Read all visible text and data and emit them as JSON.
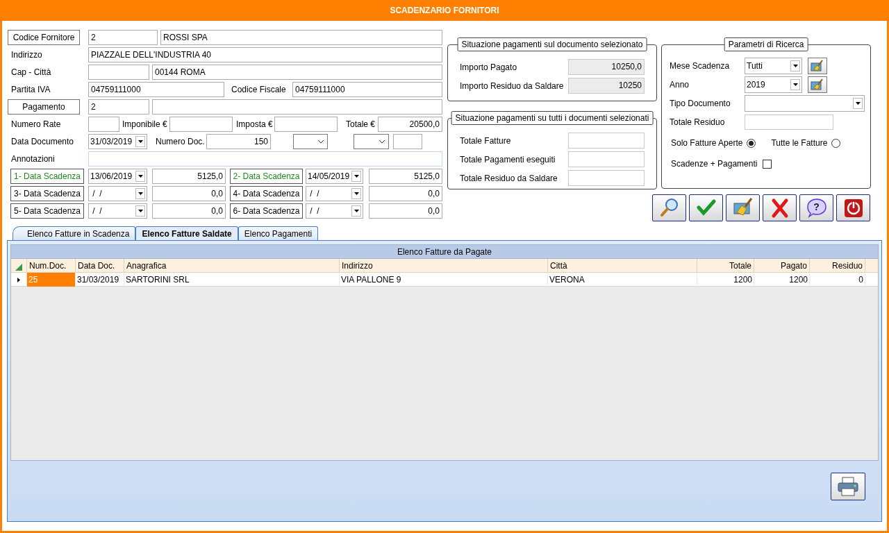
{
  "window": {
    "title": "SCADENZARIO FORNITORI"
  },
  "supplier": {
    "code_button": "Codice Fornitore",
    "code": "2",
    "name": "ROSSI SPA",
    "address_label": "Indirizzo",
    "address": "PIAZZALE DELL'INDUSTRIA 40",
    "city_label": "Cap - Città",
    "city": "00144 ROMA",
    "vat_label": "Partita IVA",
    "vat": "04759111000",
    "tax_code_label": "Codice Fiscale",
    "tax_code": "04759111000",
    "payment_button": "Pagamento",
    "payment": "2"
  },
  "document": {
    "installments_label": "Numero Rate",
    "taxable_label": "Imponibile €",
    "tax_label": "Imposta €",
    "total_label": "Totale €",
    "total": "20500,0",
    "date_label": "Data Documento",
    "date": "31/03/2019",
    "number_label": "Numero Doc.",
    "number": "150",
    "notes_label": "Annotazioni"
  },
  "due_dates": [
    {
      "label": "1- Data Scadenza",
      "date": "13/06/2019",
      "amount": "5125,0",
      "highlighted": true
    },
    {
      "label": "2- Data Scadenza",
      "date": "14/05/2019",
      "amount": "5125,0",
      "highlighted": true
    },
    {
      "label": "3- Data Scadenza",
      "date": " /  /",
      "amount": "0,0",
      "highlighted": false
    },
    {
      "label": "4- Data Scadenza",
      "date": " /  /",
      "amount": "0,0",
      "highlighted": false
    },
    {
      "label": "5- Data Scadenza",
      "date": " /  /",
      "amount": "0,0",
      "highlighted": false
    },
    {
      "label": "6- Data Scadenza",
      "date": " /  /",
      "amount": "0,0",
      "highlighted": false
    }
  ],
  "selected_document": {
    "title": "Situazione pagamenti sul documento selezionato",
    "rows": [
      {
        "label": "Importo Pagato",
        "value": "10250,0"
      },
      {
        "label": "Importo Residuo da Saldare",
        "value": "10250"
      }
    ]
  },
  "all_documents": {
    "title": "Situazione pagamenti su tutti i documenti selezionati",
    "rows": [
      {
        "label": "Totale Fatture"
      },
      {
        "label": "Totale Pagamenti eseguiti"
      },
      {
        "label": "Totale Residuo da Saldare"
      }
    ]
  },
  "search": {
    "title": "Parametri di Ricerca",
    "month_label": "Mese Scadenza",
    "month": "Tutti",
    "year_label": "Anno",
    "year": "2019",
    "doc_type_label": "Tipo Documento",
    "residual_label": "Totale Residuo",
    "filters": [
      {
        "label": "Solo Fatture Aperte",
        "selected": true
      },
      {
        "label": "Tutte le Fatture",
        "selected": false
      }
    ],
    "with_payments": {
      "label": "Scadenze + Pagamenti",
      "checked": false
    }
  },
  "toolbar": [
    {
      "kind": "search"
    },
    {
      "kind": "confirm"
    },
    {
      "kind": "clear"
    },
    {
      "kind": "delete"
    },
    {
      "kind": "help",
      "glyph": "?"
    },
    {
      "kind": "exit"
    }
  ],
  "tabs": [
    {
      "label": "Elenco Fatture in Scadenza",
      "selected": false
    },
    {
      "label": "Elenco Fatture Saldate",
      "selected": true
    },
    {
      "label": "Elenco Pagamenti",
      "selected": false
    }
  ],
  "table": {
    "title": "Elenco Fatture da Pagate",
    "columns": [
      "Num.Doc.",
      "Data Doc.",
      "Anagrafica",
      "Indirizzo",
      "Città",
      "Totale",
      "Pagato",
      "Residuo"
    ],
    "rows": [
      {
        "cells": [
          "25",
          "31/03/2019",
          "SARTORINI SRL",
          "VIA PALLONE 9",
          "VERONA",
          "1200",
          "1200",
          "0"
        ],
        "selected": true
      }
    ]
  }
}
